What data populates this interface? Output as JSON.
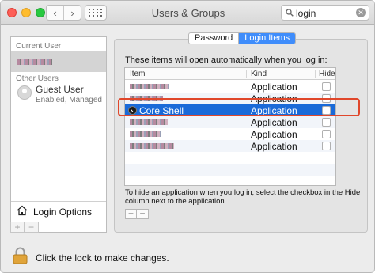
{
  "window": {
    "title": "Users & Groups",
    "nav_back": "‹",
    "nav_forward": "›"
  },
  "search": {
    "value": "login",
    "clear_glyph": "✕"
  },
  "sidebar": {
    "current_user_header": "Current User",
    "other_users_header": "Other Users",
    "guest_name": "Guest User",
    "guest_status": "Enabled, Managed",
    "login_options_label": "Login Options",
    "add_label": "+",
    "remove_label": "−"
  },
  "tabs": [
    {
      "label": "Password",
      "active": false
    },
    {
      "label": "Login Items",
      "active": true
    }
  ],
  "login_items": {
    "intro": "These items will open automatically when you log in:",
    "columns": {
      "item": "Item",
      "kind": "Kind",
      "hide": "Hide"
    },
    "rows": [
      {
        "name": "",
        "kind": "Application",
        "hidden": false,
        "selected": false,
        "blurred": true
      },
      {
        "name": "",
        "kind": "Application",
        "hidden": false,
        "selected": false,
        "blurred": true
      },
      {
        "name": "Core Shell",
        "kind": "Application",
        "hidden": false,
        "selected": true,
        "blurred": false
      },
      {
        "name": "",
        "kind": "Application",
        "hidden": false,
        "selected": false,
        "blurred": true
      },
      {
        "name": "",
        "kind": "Application",
        "hidden": false,
        "selected": false,
        "blurred": true
      },
      {
        "name": "",
        "kind": "Application",
        "hidden": false,
        "selected": false,
        "blurred": true
      }
    ],
    "hint": "To hide an application when you log in, select the checkbox in the Hide column next to the application.",
    "add_label": "+",
    "remove_label": "−"
  },
  "lock": {
    "text": "Click the lock to make changes."
  },
  "colors": {
    "selection": "#1a6ad8",
    "tab_active": "#3f8dfb",
    "annotation_outline": "#e0472b"
  }
}
